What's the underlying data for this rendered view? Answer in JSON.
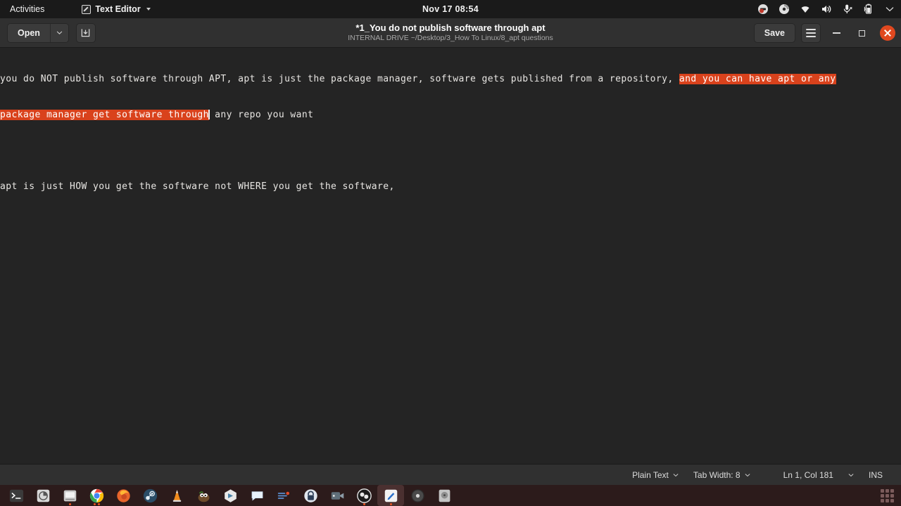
{
  "top_bar": {
    "activities_label": "Activities",
    "app_name": "Text Editor",
    "clock": "Nov 17  08:54",
    "tray_icons": [
      "screencast-recording-icon",
      "disk-icon",
      "wifi-icon",
      "volume-icon",
      "microphone-muted-icon",
      "battery-icon",
      "chevron-down-icon"
    ]
  },
  "header": {
    "open_label": "Open",
    "open_dropdown_icon": "chevron-down-icon",
    "save_as_icon": "save-to-file-icon",
    "title": "*1_You do not publish software through apt",
    "subtitle": "INTERNAL DRIVE ~/Desktop/3_How To Linux/8_apt questions",
    "save_label": "Save",
    "menu_icon": "hamburger-menu-icon",
    "minimize_icon": "minimize-icon",
    "maximize_icon": "maximize-icon",
    "close_icon": "close-icon"
  },
  "editor": {
    "line1_a": "you do NOT publish software through APT, apt is just the package manager, software gets published from a repository, ",
    "line1_sel": "and you can have apt or any",
    "line2_sel": "package manager get software through",
    "line2_b": " any repo you want",
    "line4": "apt is just HOW you get the software not WHERE you get the software,",
    "selection_color": "#d9421c",
    "cursor_icon": "text-ibeam-cursor"
  },
  "status_bar": {
    "language": "Plain Text",
    "tab_width": "Tab Width: 8",
    "position": "Ln 1, Col 181",
    "insert_mode": "INS",
    "dropdown_icon": "chevron-down-icon"
  },
  "dock": {
    "items": [
      {
        "name": "terminal",
        "running": false
      },
      {
        "name": "disk-usage-analyzer",
        "running": false
      },
      {
        "name": "files",
        "running": true
      },
      {
        "name": "google-chrome",
        "running": true,
        "dots": 2
      },
      {
        "name": "firefox",
        "running": false
      },
      {
        "name": "steam",
        "running": false
      },
      {
        "name": "vlc-media-player",
        "running": false
      },
      {
        "name": "gimp",
        "running": false
      },
      {
        "name": "vscodium",
        "running": false
      },
      {
        "name": "messaging",
        "running": false
      },
      {
        "name": "audio-editor",
        "running": false
      },
      {
        "name": "password-manager",
        "running": false
      },
      {
        "name": "video-editor",
        "running": false
      },
      {
        "name": "obs-studio",
        "running": true
      },
      {
        "name": "text-editor",
        "running": true,
        "active": true
      },
      {
        "name": "disc-burner",
        "running": false
      },
      {
        "name": "disks-utility",
        "running": false
      }
    ],
    "show_apps_label": "Show Applications"
  }
}
